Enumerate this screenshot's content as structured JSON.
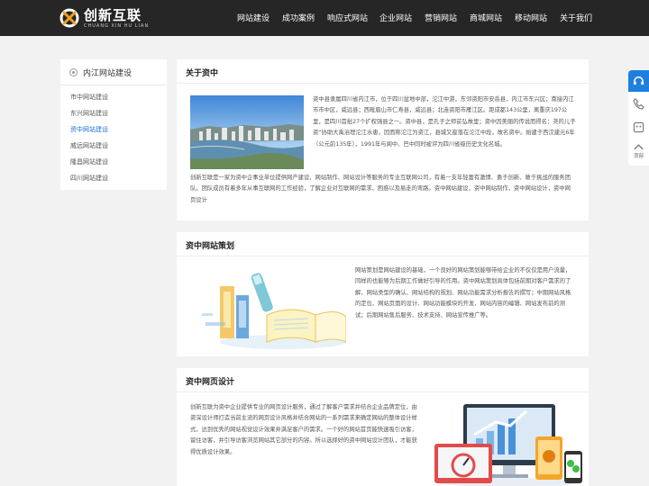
{
  "header": {
    "logo_text": "创新互联",
    "logo_sub": "CHUANG XIN HU LIAN",
    "nav": [
      "网站建设",
      "成功案例",
      "响应式网站",
      "企业网站",
      "营销网站",
      "商城网站",
      "移动网站",
      "关于我们"
    ]
  },
  "sidebar": {
    "title": "内江网站建设",
    "items": [
      "市中网站建设",
      "东兴网站建设",
      "资中网站建设",
      "威远网站建设",
      "隆昌网站建设",
      "四川网站建设"
    ]
  },
  "about": {
    "title": "关于资中",
    "side_text": "资中县隶属四川省内江市，位于四川盆地中部，沱江中游，东邻资阳市安岳县，内江市东兴区；南接内江市市中区，威远县；西毗眉山市仁寿县，威远县；北连资阳市雁江区。距成都143公里，离重庆197公里，是四川首批27个扩权强县之一。资中县，是孔子之师苌弘故里；资中因美丽的传说而得名：尧的儿子资“协助大禹治理沱江水患，因而称沱江为资江，县城又座落在沱江中段，故名资中。始建于西汉建元6年（公元前135年），1991年与阆中、巴中同时被评为四川省级历史文化名城。",
    "full_text": "创新互联是一家为资中企事业单位提供网产建设、网站制作、网站设计等服务的专业互联网公司，有着一支年轻富有激情、勇于创新、敢于挑战的服务团队。团队成员有着多年从事互联网的工作经验，了解企业对互联网的需求、困惑以及易走的弯路。资中网站建设，资中网站制作，资中网站设计，资中网页设计"
  },
  "planning": {
    "title": "资中网站策划",
    "text": "网站策划是网站建设的基础，一个良好的网站策划能够带给企业的不仅仅是用户流量，同样的也能够为后期工作做好引导的作用。资中网站策划具体包括前期对客户需求的了解、网站类型的确认、网站结构的规划、网站功能需求分析报告的撰写；中期网站风格的定位、网站页面的设计、网站功能模块的开发、网站内容的编辑、网站发布前的测试；后期网站售后服务、技术支持、网站宣传推广等。"
  },
  "design": {
    "title": "资中网页设计",
    "text": "创新互联为资中企业提供专业的网页设计服务，通过了解客户需求并结合企业品牌定位，由资深设计师打造当前主流的网页设计风格并结合网站的一系列需求来确定网站的整体设计样式，达到优秀的网站视觉设计效果并满足客户的需求。一个好的网站首页能快速吸引访客，留住访客，并引导访客浏览网站其它部分的内容。所以选择好的资中网站设计团队，才能获得优质设计效果。"
  },
  "rail": {
    "top_label": "顶部"
  },
  "colors": {
    "header_bg": "#262626",
    "accent": "#1a6fd8",
    "logo_orange": "#f0a020"
  }
}
